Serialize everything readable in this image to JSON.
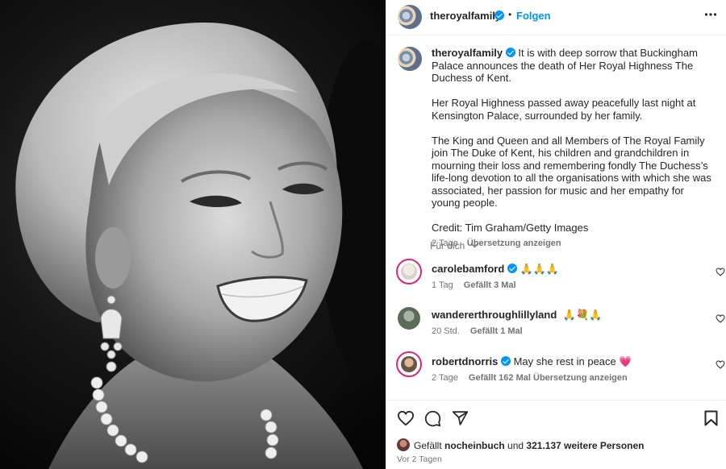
{
  "post": {
    "author": "theroyalfamily",
    "follow_label": "Folgen",
    "separator": "•",
    "more_icon": "more-horizontal-icon"
  },
  "caption": {
    "author": "theroyalfamily",
    "paragraph1": "It is with deep sorrow that Buckingham Palace announces the death of Her Royal Highness The Duchess of Kent.",
    "paragraph2": "Her Royal Highness passed away peacefully last night at Kensington Palace, surrounded by her family.",
    "paragraph3": "The King and Queen and all Members of The Royal Family join The Duke of Kent, his children and grandchildren in mourning their loss and remembering fondly The Duchess’s life-long devotion to all the organisations with which she was associated, her passion for music and her empathy for young people.",
    "credit": "Credit: Tim Graham/Getty Images",
    "age": "2 Tage",
    "translate": "Übersetzung anzeigen"
  },
  "for_you": {
    "label": "Für dich"
  },
  "comments": [
    {
      "user": "carolebamford",
      "verified": true,
      "text": "🙏🙏🙏",
      "age": "1 Tag",
      "likes": "Gefällt 3 Mal",
      "translate": ""
    },
    {
      "user": "wandererthroughlillyland",
      "verified": false,
      "text": "🙏💐🙏",
      "age": "20 Std.",
      "likes": "Gefällt 1 Mal",
      "translate": ""
    },
    {
      "user": "robertdnorris",
      "verified": true,
      "text": "May she rest in peace 💗",
      "age": "2 Tage",
      "likes": "Gefällt 162 Mal",
      "translate": "Übersetzung anzeigen"
    }
  ],
  "likes": {
    "prefix": "Gefällt",
    "user": "nocheinbuch",
    "middle": "und",
    "count": "321.137 weitere Personen"
  },
  "posted": "Vor 2 Tagen",
  "colors": {
    "accent": "#0095f6",
    "muted": "#737373",
    "text": "#262626",
    "heart": "#ed4f8c"
  }
}
